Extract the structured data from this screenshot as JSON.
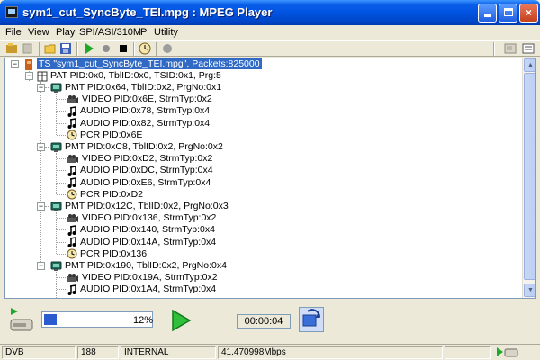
{
  "window": {
    "title": "sym1_cut_SyncByte_TEI.mpg : MPEG Player",
    "minimize_label": "",
    "maximize_label": "",
    "close_label": "×"
  },
  "menu": [
    "File",
    "View",
    "Play",
    "SPI/ASI/310M",
    "IP",
    "Utility"
  ],
  "tree": {
    "root": "TS \"sym1_cut_SyncByte_TEI.mpg\", Packets:825000",
    "pat": "PAT PID:0x0, TblID:0x0, TSID:0x1, Prg:5",
    "programs": [
      {
        "label": "PMT PID:0x64, TblID:0x2, PrgNo:0x1",
        "streams": [
          {
            "type": "video",
            "label": "VIDEO PID:0x6E, StrmTyp:0x2"
          },
          {
            "type": "audio",
            "label": "AUDIO PID:0x78, StrmTyp:0x4"
          },
          {
            "type": "audio",
            "label": "AUDIO PID:0x82, StrmTyp:0x4"
          },
          {
            "type": "pcr",
            "label": "PCR PID:0x6E"
          }
        ]
      },
      {
        "label": "PMT PID:0xC8, TblID:0x2, PrgNo:0x2",
        "streams": [
          {
            "type": "video",
            "label": "VIDEO PID:0xD2, StrmTyp:0x2"
          },
          {
            "type": "audio",
            "label": "AUDIO PID:0xDC, StrmTyp:0x4"
          },
          {
            "type": "audio",
            "label": "AUDIO PID:0xE6, StrmTyp:0x4"
          },
          {
            "type": "pcr",
            "label": "PCR PID:0xD2"
          }
        ]
      },
      {
        "label": "PMT PID:0x12C, TblID:0x2, PrgNo:0x3",
        "streams": [
          {
            "type": "video",
            "label": "VIDEO PID:0x136, StrmTyp:0x2"
          },
          {
            "type": "audio",
            "label": "AUDIO PID:0x140, StrmTyp:0x4"
          },
          {
            "type": "audio",
            "label": "AUDIO PID:0x14A, StrmTyp:0x4"
          },
          {
            "type": "pcr",
            "label": "PCR PID:0x136"
          }
        ]
      },
      {
        "label": "PMT PID:0x190, TblID:0x2, PrgNo:0x4",
        "streams": [
          {
            "type": "video",
            "label": "VIDEO PID:0x19A, StrmTyp:0x2"
          },
          {
            "type": "audio",
            "label": "AUDIO PID:0x1A4, StrmTyp:0x4"
          }
        ]
      }
    ]
  },
  "player": {
    "progress_percent": 12,
    "progress_text": "12%",
    "time": "00:00:04"
  },
  "status": {
    "standard": "DVB",
    "packet_size": "188",
    "clock": "INTERNAL",
    "bitrate": "41.470998Mbps"
  },
  "colors": {
    "title_bar": "#0053e1",
    "selection": "#316ac5",
    "progress": "#2a5cd0",
    "play_green": "#1fa82a"
  }
}
